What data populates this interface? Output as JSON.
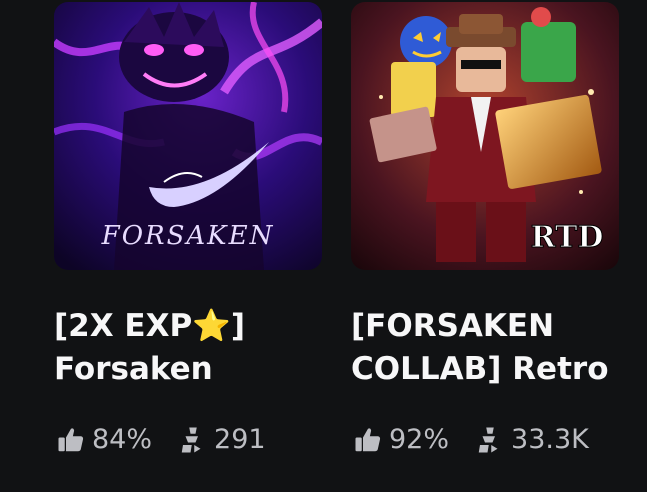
{
  "games": [
    {
      "title_line1_prefix": "[2X EXP",
      "title_line1_star": "⭐",
      "title_line1_suffix": "]",
      "title_line2": "Forsaken",
      "logo_text": "FORSAKEN",
      "rating": "84%",
      "players": "291",
      "icons": {
        "rating": "thumbs-up-icon",
        "players": "players-icon"
      }
    },
    {
      "title_line1": "[FORSAKEN",
      "title_line2": "COLLAB] Retro",
      "logo_text": "RTD",
      "rating": "92%",
      "players": "33.3K",
      "icons": {
        "rating": "thumbs-up-icon",
        "players": "players-icon"
      }
    }
  ],
  "colors": {
    "background": "#111214",
    "title": "#f7f7f8",
    "stats": "#bdbec3",
    "star": "#f5b21b"
  }
}
